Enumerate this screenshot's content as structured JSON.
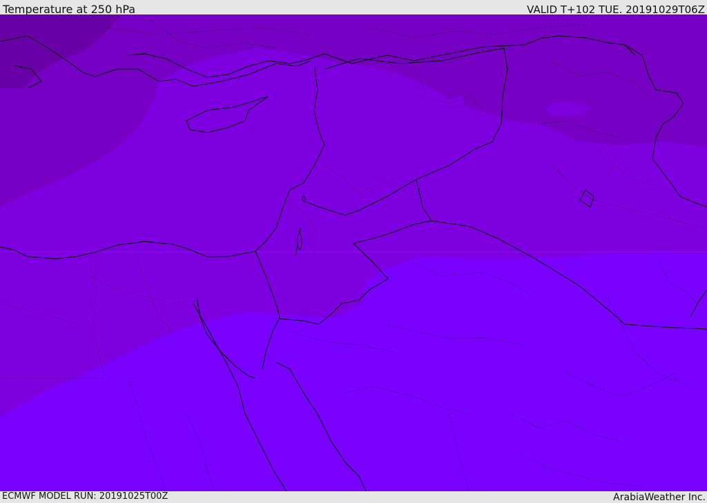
{
  "header": {
    "title": "Temperature at 250 hPa",
    "valid": "VALID T+102 TUE. 20191029T06Z"
  },
  "footer": {
    "model_run": "ECMWF MODEL RUN: 20191025T00Z",
    "credit": "ArabiaWeather Inc."
  },
  "colors": {
    "band_coldest": "#6a00a8",
    "band_cold": "#7600c4",
    "band_mid": "#7e00e0",
    "band_warm": "#7a00ff",
    "coastline": "#000000"
  }
}
